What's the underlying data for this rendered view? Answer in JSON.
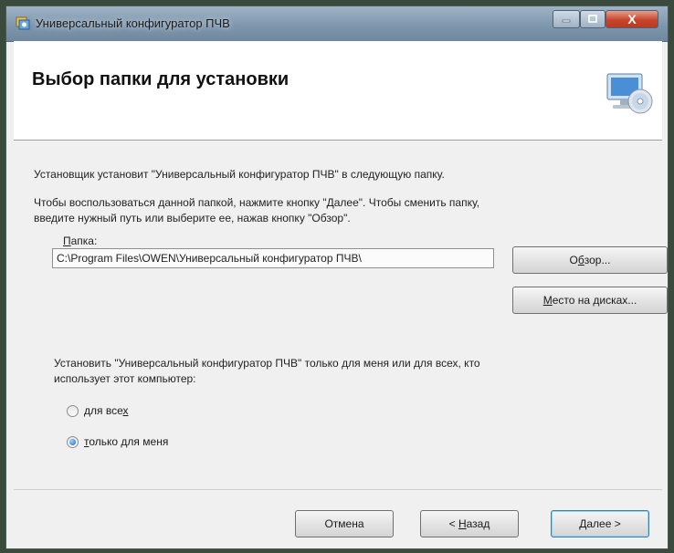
{
  "window": {
    "title": "Универсальный конфигуратор ПЧВ",
    "close_glyph": "X"
  },
  "header": {
    "title": "Выбор папки для установки"
  },
  "body": {
    "intro": "Установщик установит \"Универсальный конфигуратор ПЧВ\" в следующую папку.",
    "instruction_line1": "Чтобы воспользоваться данной папкой, нажмите кнопку \"Далее\". Чтобы сменить папку,",
    "instruction_line2": "введите нужный путь или выберите ее, нажав кнопку \"Обзор\".",
    "folder_label_accel": "П",
    "folder_label_rest": "апка:",
    "folder_path": "C:\\Program Files\\OWEN\\Универсальный конфигуратор ПЧВ\\",
    "browse_btn_pre": "О",
    "browse_btn_accel": "б",
    "browse_btn_post": "зор...",
    "disk_btn_accel": "М",
    "disk_btn_rest": "есто на дисках...",
    "scope_question_line1": "Установить \"Универсальный конфигуратор ПЧВ\" только для меня или для всех, кто",
    "scope_question_line2": "использует этот компьютер:",
    "radio_all_pre": "для все",
    "radio_all_accel": "х",
    "radio_me_accel": "т",
    "radio_me_rest": "олько для меня",
    "selected_scope": "только для меня"
  },
  "footer": {
    "cancel_label": "Отмена",
    "back_prefix": "< ",
    "back_accel": "Н",
    "back_rest": "азад",
    "next_label": "Далее >"
  }
}
